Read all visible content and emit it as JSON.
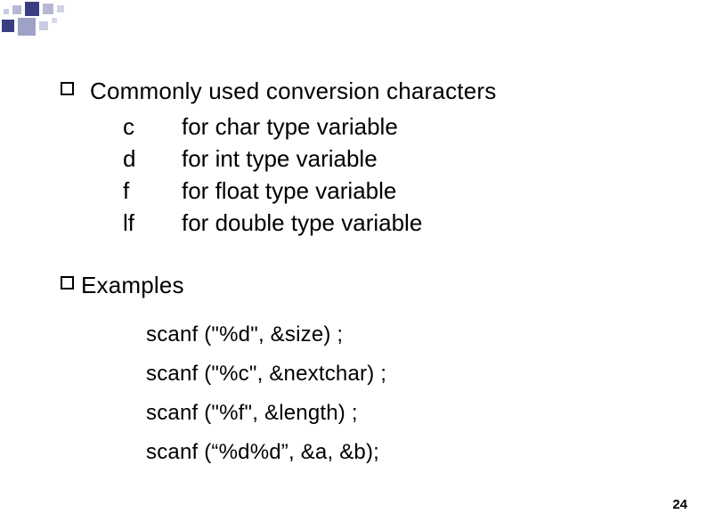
{
  "heading1": "Commonly used conversion characters",
  "conversions": [
    {
      "key": "c",
      "desc": "for char type variable"
    },
    {
      "key": "d",
      "desc": "for int type variable"
    },
    {
      "key": "f",
      "desc": "for float type variable"
    },
    {
      "key": "lf",
      "desc": "for double type variable"
    }
  ],
  "heading2": "Examples",
  "examples": [
    "scanf (\"%d\", &size) ;",
    "scanf (\"%c\", &nextchar) ;",
    "scanf (\"%f\", &length) ;",
    "scanf (“%d%d”, &a, &b);"
  ],
  "pageNumber": "24"
}
